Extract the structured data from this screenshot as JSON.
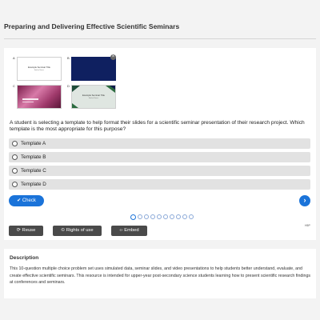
{
  "page": {
    "title": "Preparing and Delivering Effective Scientific Seminars"
  },
  "templates": [
    {
      "letter": "A",
      "slide_title": "Example Seminar Title",
      "slide_subtitle": "Author Name"
    },
    {
      "letter": "B",
      "slide_title": "",
      "slide_subtitle": ""
    },
    {
      "letter": "C",
      "slide_title": "",
      "slide_subtitle": ""
    },
    {
      "letter": "D",
      "slide_title": "Example Seminar Title",
      "slide_subtitle": "Author Name"
    }
  ],
  "question": {
    "text": "A student is selecting a template to help format their slides for a scientific seminar presentation of their research project. Which template is the most appropriate for this purpose?",
    "options": [
      "Template A",
      "Template B",
      "Template C",
      "Template D"
    ]
  },
  "controls": {
    "check_label": "Check",
    "next_icon": "chevron-right-icon",
    "total_pages": 10,
    "current_page": 1
  },
  "actions": {
    "reuse_label": "Reuse",
    "rights_label": "Rights of use",
    "embed_label": "Embed",
    "brand_mark": "H5P"
  },
  "description": {
    "title": "Description",
    "text": "This 10-question multiple choice problem set uses simulated data, seminar slides, and video presentations to help students better understand, evaluate, and create effective scientific seminars. This resource is intended for upper-year post-secondary science students learning how to present scientific research findings at conferences and seminars."
  },
  "colors": {
    "accent": "#1a73d9",
    "option_bg": "#e2e2e2",
    "action_bg": "#4a4a4a",
    "page_bg": "#f3f3f3"
  }
}
